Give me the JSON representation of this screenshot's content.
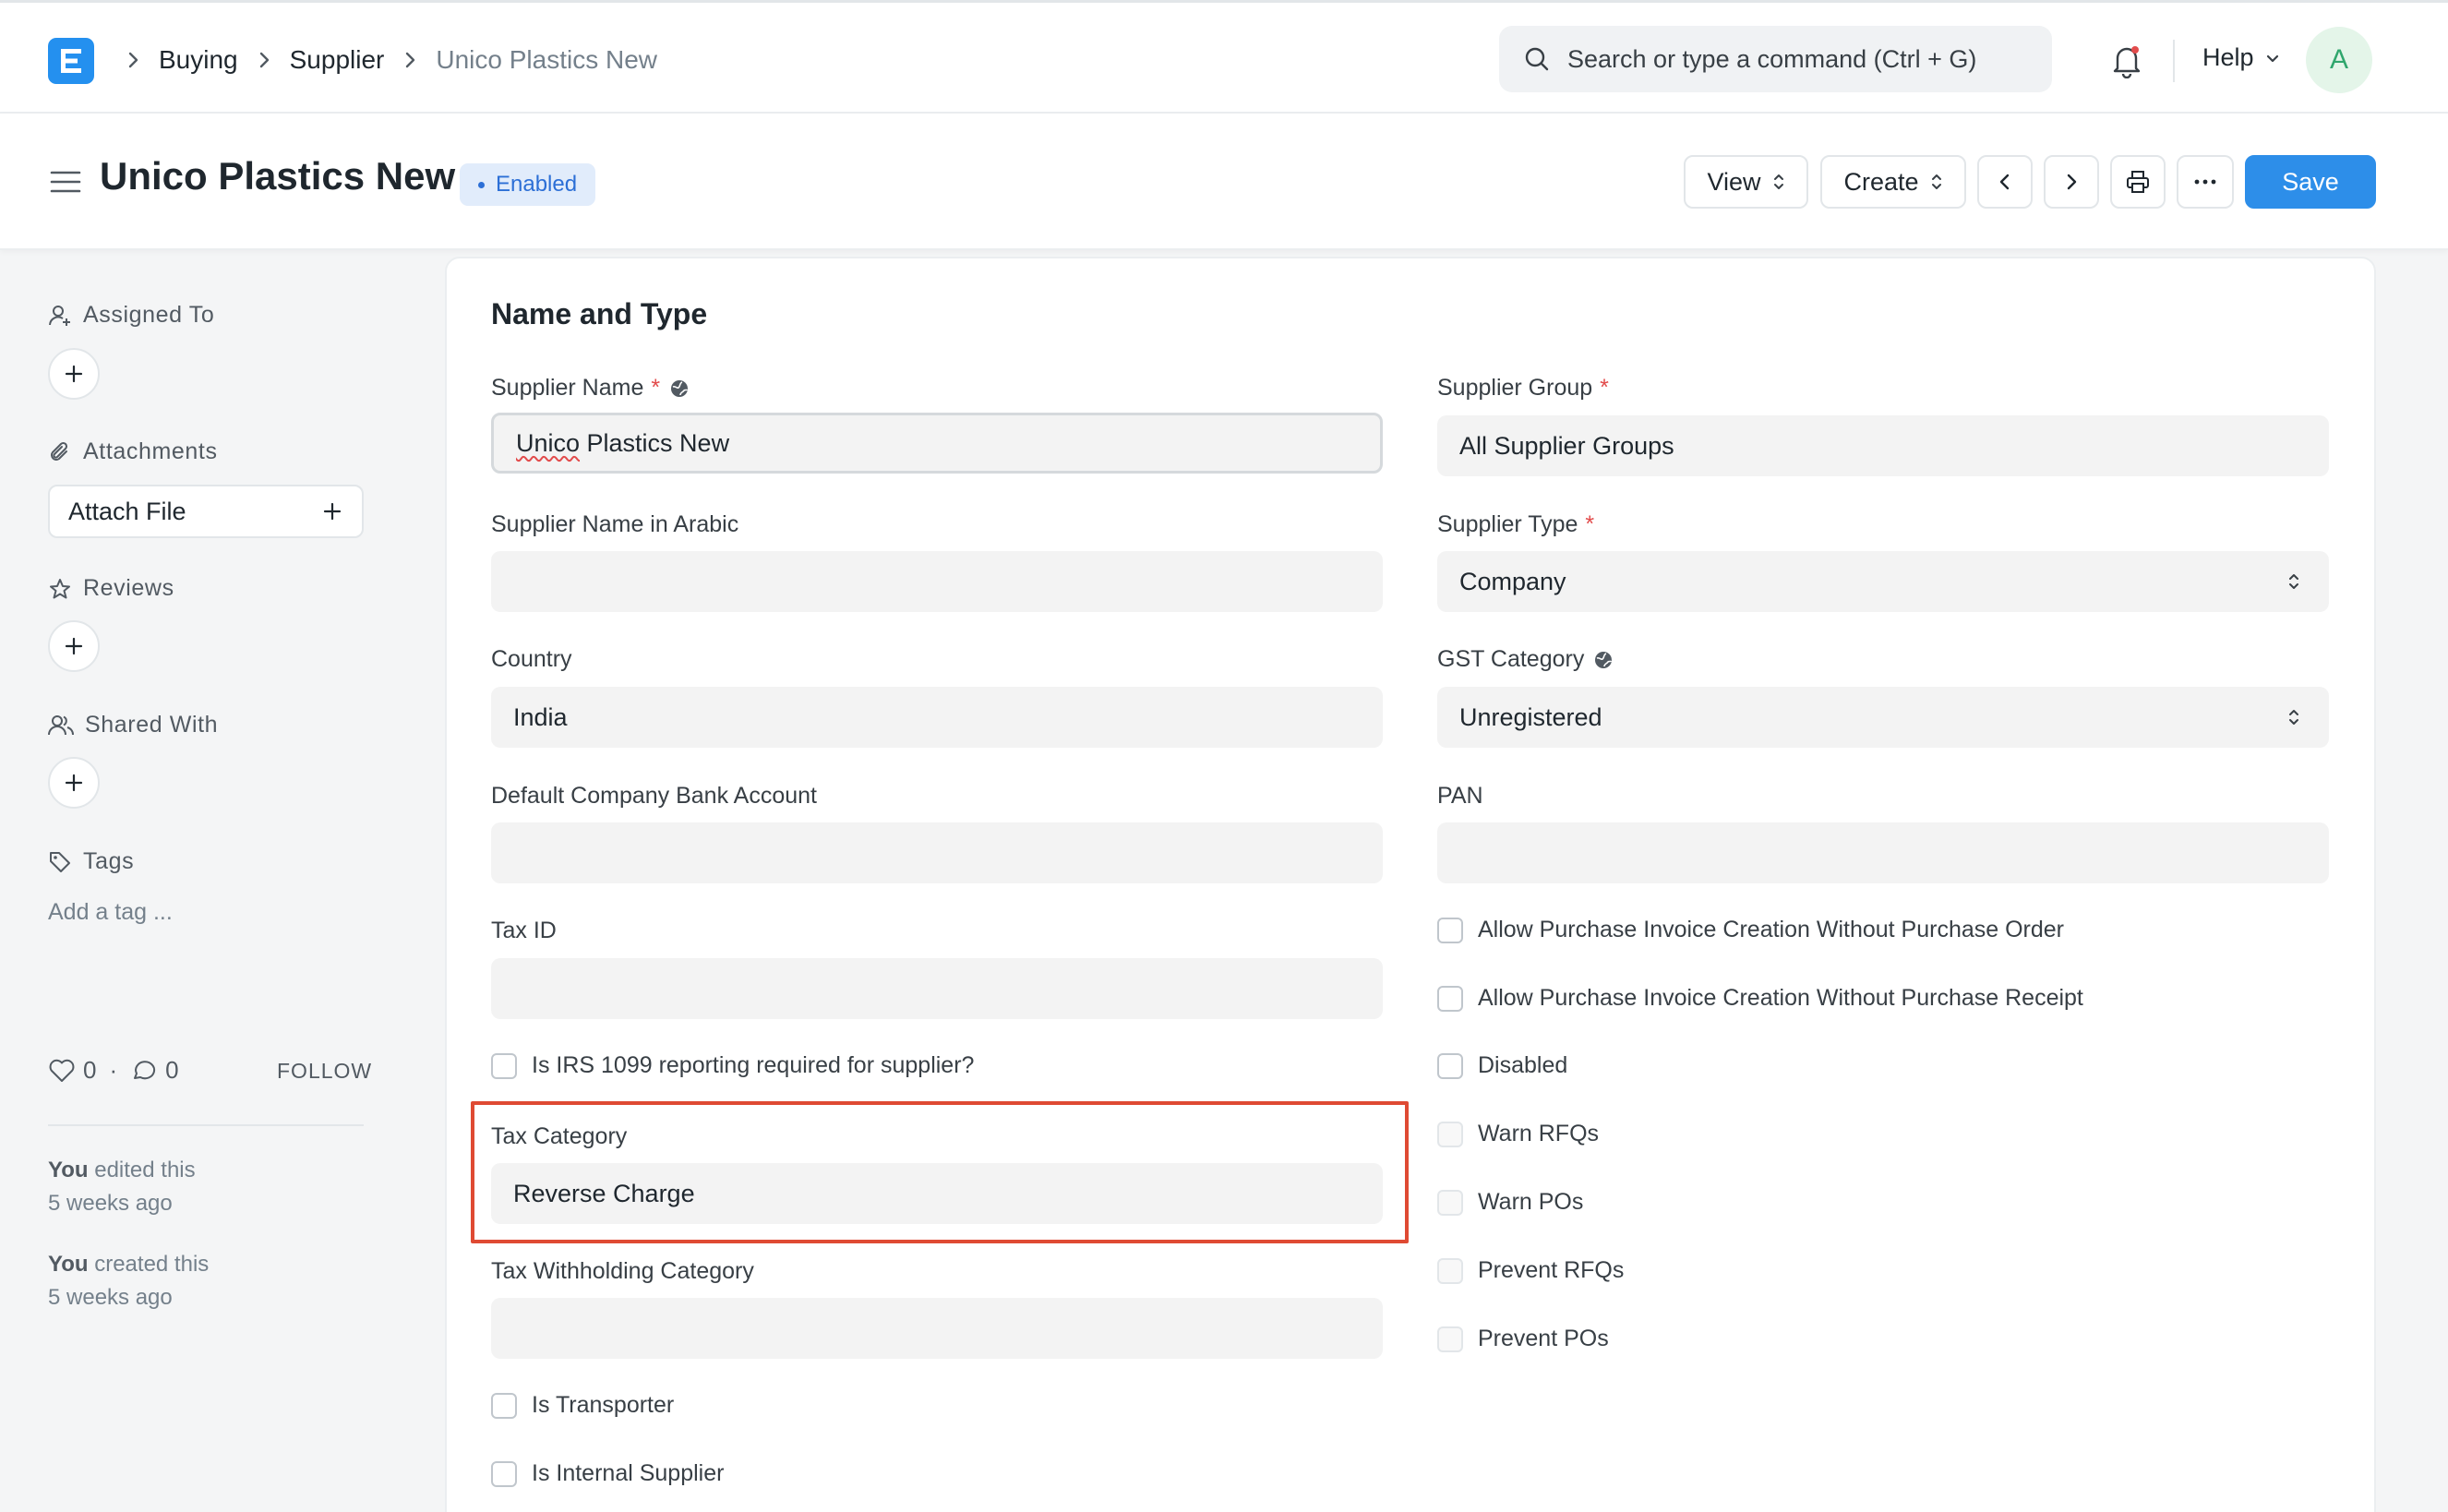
{
  "navbar": {
    "breadcrumbs": [
      "Buying",
      "Supplier",
      "Unico Plastics New"
    ],
    "search_placeholder": "Search or type a command (Ctrl + G)",
    "help_label": "Help",
    "avatar_initial": "A"
  },
  "page_head": {
    "title": "Unico Plastics New",
    "status": "Enabled",
    "view_label": "View",
    "create_label": "Create",
    "save_label": "Save"
  },
  "sidebar": {
    "assigned_to": "Assigned To",
    "attachments": "Attachments",
    "attach_file": "Attach File",
    "reviews": "Reviews",
    "shared_with": "Shared With",
    "tags": "Tags",
    "add_tag": "Add a tag ...",
    "likes": "0",
    "comments": "0",
    "follow": "FOLLOW",
    "timeline": [
      {
        "actor": "You",
        "action": " edited this",
        "when": "5 weeks ago"
      },
      {
        "actor": "You",
        "action": " created this",
        "when": "5 weeks ago"
      }
    ]
  },
  "form": {
    "section_title": "Name and Type",
    "left": {
      "supplier_name_label": "Supplier Name",
      "supplier_name_value_a": "Unico",
      "supplier_name_value_b": " Plastics New",
      "supplier_name_arabic_label": "Supplier Name in Arabic",
      "supplier_name_arabic_value": "",
      "country_label": "Country",
      "country_value": "India",
      "bank_account_label": "Default Company Bank Account",
      "bank_account_value": "",
      "tax_id_label": "Tax ID",
      "tax_id_value": "",
      "irs_1099_label": "Is IRS 1099 reporting required for supplier?",
      "tax_category_label": "Tax Category",
      "tax_category_value": "Reverse Charge",
      "tax_withholding_label": "Tax Withholding Category",
      "tax_withholding_value": "",
      "is_transporter_label": "Is Transporter",
      "is_internal_label": "Is Internal Supplier"
    },
    "right": {
      "supplier_group_label": "Supplier Group",
      "supplier_group_value": "All Supplier Groups",
      "supplier_type_label": "Supplier Type",
      "supplier_type_value": "Company",
      "gst_category_label": "GST Category",
      "gst_category_value": "Unregistered",
      "pan_label": "PAN",
      "pan_value": "",
      "checks": [
        "Allow Purchase Invoice Creation Without Purchase Order",
        "Allow Purchase Invoice Creation Without Purchase Receipt",
        "Disabled",
        "Warn RFQs",
        "Warn POs",
        "Prevent RFQs",
        "Prevent POs"
      ]
    }
  },
  "colors": {
    "primary": "#2d8ee9",
    "highlight": "#df4a33",
    "required": "#e24c4c"
  }
}
